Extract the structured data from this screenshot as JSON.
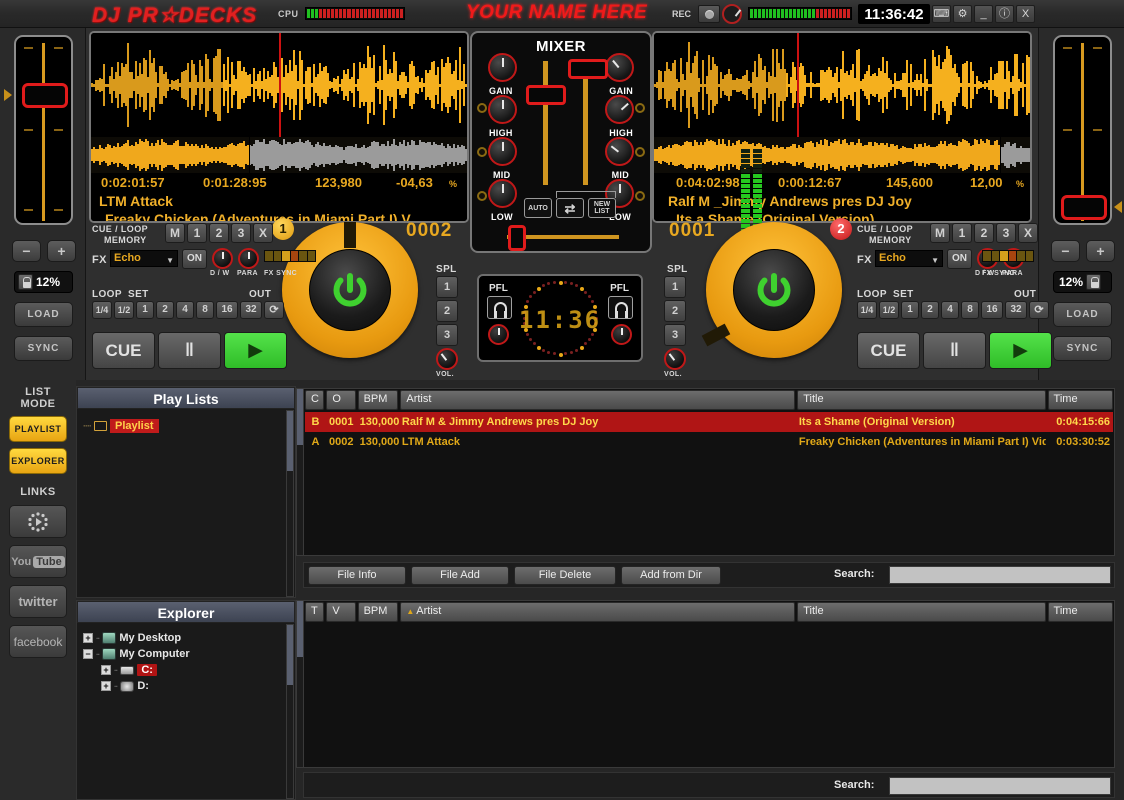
{
  "header": {
    "logo": "DJ PR☆DECKS",
    "cpu_label": "CPU",
    "your_name": "YOUR NAME HERE",
    "rec_label": "REC",
    "clock": "11:36:42",
    "win_buttons": [
      "⌨",
      "⚙",
      "_",
      "ⓘ",
      "X"
    ]
  },
  "decks": {
    "left": {
      "elapsed": "0:02:01:57",
      "remain": "0:01:28:95",
      "bpm": "123,980",
      "pitch_pct": "-04,63",
      "pct_sign": "%",
      "artist": "LTM Attack",
      "title": "Freaky Chicken (Adventures in Miami Part I) V",
      "counter": "0002",
      "number": "1",
      "cue_loop_label_1": "CUE / LOOP",
      "cue_loop_label_2": "MEMORY",
      "memory_buttons": [
        "M",
        "1",
        "2",
        "3",
        "X"
      ],
      "fx_label": "FX",
      "fx_value": "Echo",
      "fx_on": "ON",
      "dw_label": "D / W",
      "para_label": "PARA",
      "fxsync_label": "FX SYNC",
      "loop_label": "LOOP",
      "set_label": "SET",
      "out_label": "OUT",
      "loop_buttons": [
        "1/4",
        "1/2",
        "1",
        "2",
        "4",
        "8",
        "16",
        "32"
      ],
      "cue_btn": "CUE",
      "pause_btn": "‖",
      "play_btn": "▶",
      "spl_label": "SPL",
      "spl_buttons": [
        "1",
        "2",
        "3"
      ],
      "vol_label": "VOL.",
      "pitch_display": "12%",
      "load_btn": "LOAD",
      "sync_btn": "SYNC",
      "minus_btn": "−",
      "plus_btn": "+"
    },
    "right": {
      "elapsed": "0:04:02:98",
      "remain": "0:00:12:67",
      "bpm": "145,600",
      "pitch_pct": "12,00",
      "pct_sign": "%",
      "artist": "Ralf M _Jimmy Andrews pres DJ Joy",
      "title": "Its a Shame (Original Version)",
      "counter": "0001",
      "number": "2",
      "cue_loop_label_1": "CUE / LOOP",
      "cue_loop_label_2": "MEMORY",
      "memory_buttons": [
        "M",
        "1",
        "2",
        "3",
        "X"
      ],
      "fx_label": "FX",
      "fx_value": "Echo",
      "fx_on": "ON",
      "dw_label": "D / W",
      "para_label": "PARA",
      "fxsync_label": "FX SYNC",
      "loop_label": "LOOP",
      "set_label": "SET",
      "out_label": "OUT",
      "loop_buttons": [
        "1/4",
        "1/2",
        "1",
        "2",
        "4",
        "8",
        "16",
        "32"
      ],
      "cue_btn": "CUE",
      "pause_btn": "‖",
      "play_btn": "▶",
      "spl_label": "SPL",
      "spl_buttons": [
        "1",
        "2",
        "3"
      ],
      "vol_label": "VOL.",
      "pitch_display": "12%",
      "load_btn": "LOAD",
      "sync_btn": "SYNC",
      "minus_btn": "−",
      "plus_btn": "+"
    }
  },
  "mixer": {
    "title": "MIXER",
    "knob_labels": [
      "GAIN",
      "HIGH",
      "MID",
      "LOW"
    ],
    "auto_btn": "AUTO",
    "shuffle_btn": "⇄",
    "newlist_btn_1": "NEW",
    "newlist_btn_2": "LIST"
  },
  "center_display": {
    "pfl_left": "PFL",
    "pfl_right": "PFL",
    "clock": "11:36"
  },
  "sidebar": {
    "list_mode_1": "LIST",
    "list_mode_2": "MODE",
    "playlist_btn": "PLAYLIST",
    "explorer_btn": "EXPLORER",
    "links_label": "LINKS",
    "links": [
      "prodecks-icon",
      "You Tube",
      "twitter",
      "facebook"
    ]
  },
  "playlists_panel": {
    "title": "Play Lists",
    "items": [
      {
        "label": "Playlist",
        "selected": true
      }
    ]
  },
  "explorer_panel": {
    "title": "Explorer",
    "items": [
      {
        "label": "My Desktop",
        "expand": "+",
        "icon": "computer-icon",
        "indent": 0,
        "selected": false
      },
      {
        "label": "My Computer",
        "expand": "−",
        "icon": "computer-icon",
        "indent": 0,
        "selected": false
      },
      {
        "label": "C:",
        "expand": "+",
        "icon": "harddisk-icon",
        "indent": 1,
        "selected": true
      },
      {
        "label": "D:",
        "expand": "+",
        "icon": "cdrom-icon",
        "indent": 1,
        "selected": false
      }
    ]
  },
  "playlist_table": {
    "columns": [
      "C",
      "O",
      "BPM",
      "Artist",
      "Title",
      "Time"
    ],
    "rows": [
      {
        "c": "B",
        "o": "0001",
        "bpm": "130,000",
        "artist": "Ralf M & Jimmy Andrews pres DJ Joy",
        "title": "Its a Shame (Original Version)",
        "time": "0:04:15:66",
        "selected": true
      },
      {
        "c": "A",
        "o": "0002",
        "bpm": "130,000",
        "artist": "LTM Attack",
        "title": "Freaky Chicken (Adventures in Miami Part I) Video E",
        "time": "0:03:30:52",
        "selected": false
      }
    ]
  },
  "file_toolbar": {
    "buttons": [
      "File Info",
      "File Add",
      "File Delete",
      "Add from Dir"
    ],
    "search_label": "Search:",
    "search_value": "",
    "search_placeholder": ""
  },
  "browser_table": {
    "columns": [
      "T",
      "V",
      "BPM",
      "Artist",
      "Title",
      "Time"
    ],
    "sort_icon": "sort-ascending-icon",
    "rows": []
  },
  "bottom_search": {
    "search_label": "Search:",
    "search_value": "",
    "search_placeholder": ""
  },
  "colors": {
    "amber": "#e8a820",
    "red": "#c01b1b",
    "green": "#3fc72f",
    "panel": "#2a2a2a",
    "select_red": "#b01515"
  }
}
